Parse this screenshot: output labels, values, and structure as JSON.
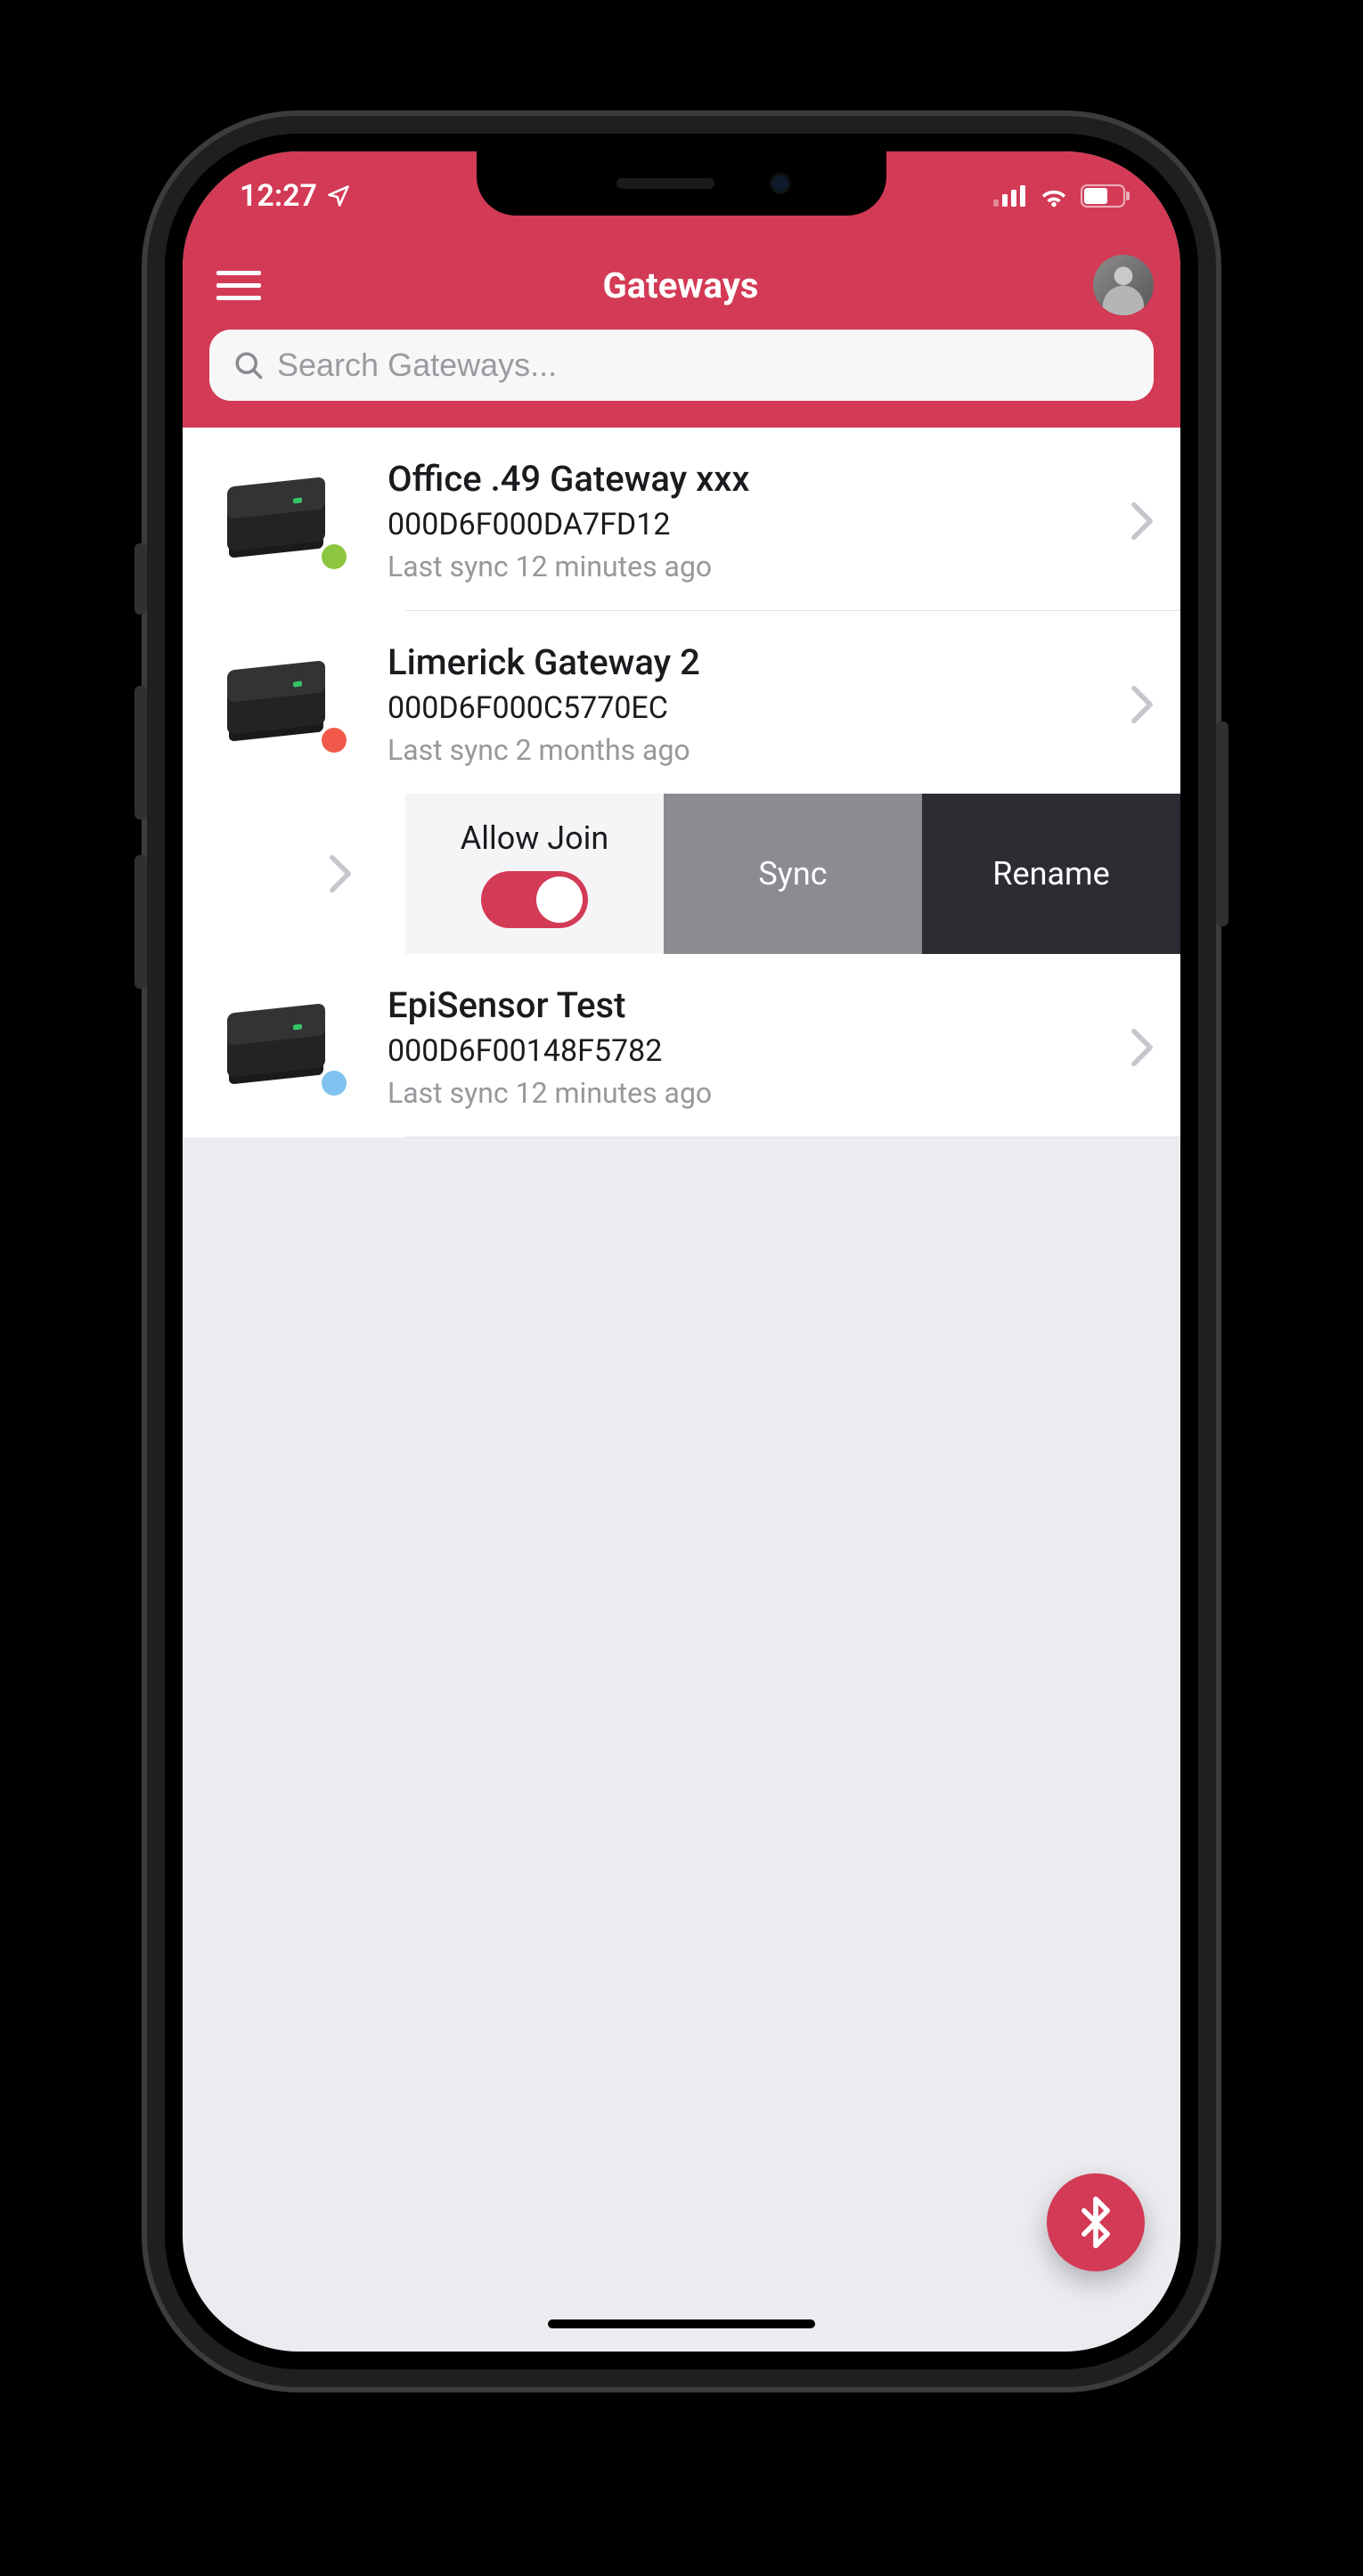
{
  "status": {
    "time": "12:27"
  },
  "header": {
    "title": "Gateways"
  },
  "search": {
    "placeholder": "Search Gateways..."
  },
  "colors": {
    "accent": "#d33a55",
    "status_green": "#8cc63f",
    "status_red": "#f15a4a",
    "status_blue": "#7fc2ef"
  },
  "gateways": [
    {
      "name": "Office .49 Gateway xxx",
      "serial": "000D6F000DA7FD12",
      "sync": "Last sync 12 minutes ago",
      "status_color": "#8cc63f"
    },
    {
      "name": "Limerick Gateway 2",
      "serial": "000D6F000C5770EC",
      "sync": "Last sync 2 months ago",
      "status_color": "#f15a4a"
    },
    {
      "name": "EpiSensor Test",
      "serial": "000D6F00148F5782",
      "sync": "Last sync 12 minutes ago",
      "status_color": "#7fc2ef"
    }
  ],
  "row_actions": {
    "allow_join_label": "Allow Join",
    "allow_join_on": true,
    "sync_label": "Sync",
    "rename_label": "Rename"
  }
}
